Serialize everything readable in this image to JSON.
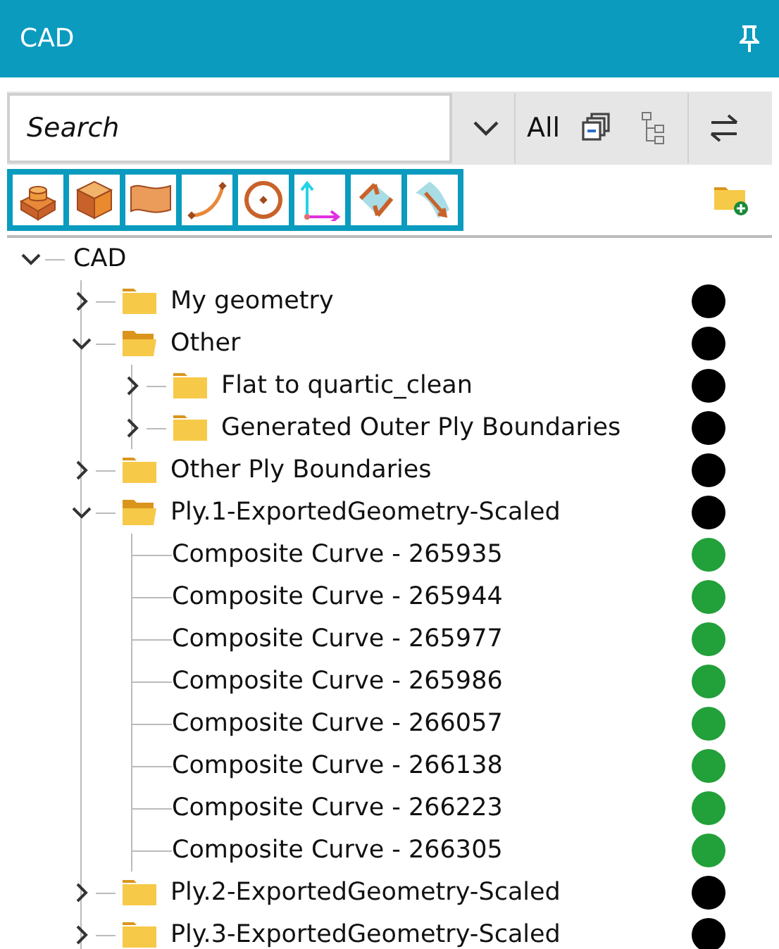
{
  "header": {
    "title": "CAD"
  },
  "search": {
    "placeholder": "Search"
  },
  "filter": {
    "value": "All"
  },
  "tree": {
    "label": "CAD",
    "kind": "root",
    "expanded": true,
    "children": [
      {
        "label": "My geometry",
        "kind": "folder",
        "expanded": false,
        "color": "#000000"
      },
      {
        "label": "Other",
        "kind": "folder",
        "expanded": true,
        "color": "#000000",
        "children": [
          {
            "label": "Flat to quartic_clean",
            "kind": "folder",
            "expanded": false,
            "color": "#000000"
          },
          {
            "label": "Generated Outer Ply Boundaries",
            "kind": "folder",
            "expanded": false,
            "color": "#000000"
          }
        ]
      },
      {
        "label": "Other Ply Boundaries",
        "kind": "folder",
        "expanded": false,
        "color": "#000000"
      },
      {
        "label": "Ply.1-ExportedGeometry-Scaled",
        "kind": "folder",
        "expanded": true,
        "color": "#000000",
        "children": [
          {
            "label": "Composite Curve - 265935",
            "kind": "curve",
            "color": "#22a03a"
          },
          {
            "label": "Composite Curve - 265944",
            "kind": "curve",
            "color": "#22a03a"
          },
          {
            "label": "Composite Curve - 265977",
            "kind": "curve",
            "color": "#22a03a"
          },
          {
            "label": "Composite Curve - 265986",
            "kind": "curve",
            "color": "#22a03a"
          },
          {
            "label": "Composite Curve - 266057",
            "kind": "curve",
            "color": "#22a03a"
          },
          {
            "label": "Composite Curve - 266138",
            "kind": "curve",
            "color": "#22a03a"
          },
          {
            "label": "Composite Curve - 266223",
            "kind": "curve",
            "color": "#22a03a"
          },
          {
            "label": "Composite Curve - 266305",
            "kind": "curve",
            "color": "#22a03a"
          }
        ]
      },
      {
        "label": "Ply.2-ExportedGeometry-Scaled",
        "kind": "folder",
        "expanded": false,
        "color": "#000000"
      },
      {
        "label": "Ply.3-ExportedGeometry-Scaled",
        "kind": "folder",
        "expanded": false,
        "color": "#000000"
      }
    ]
  }
}
